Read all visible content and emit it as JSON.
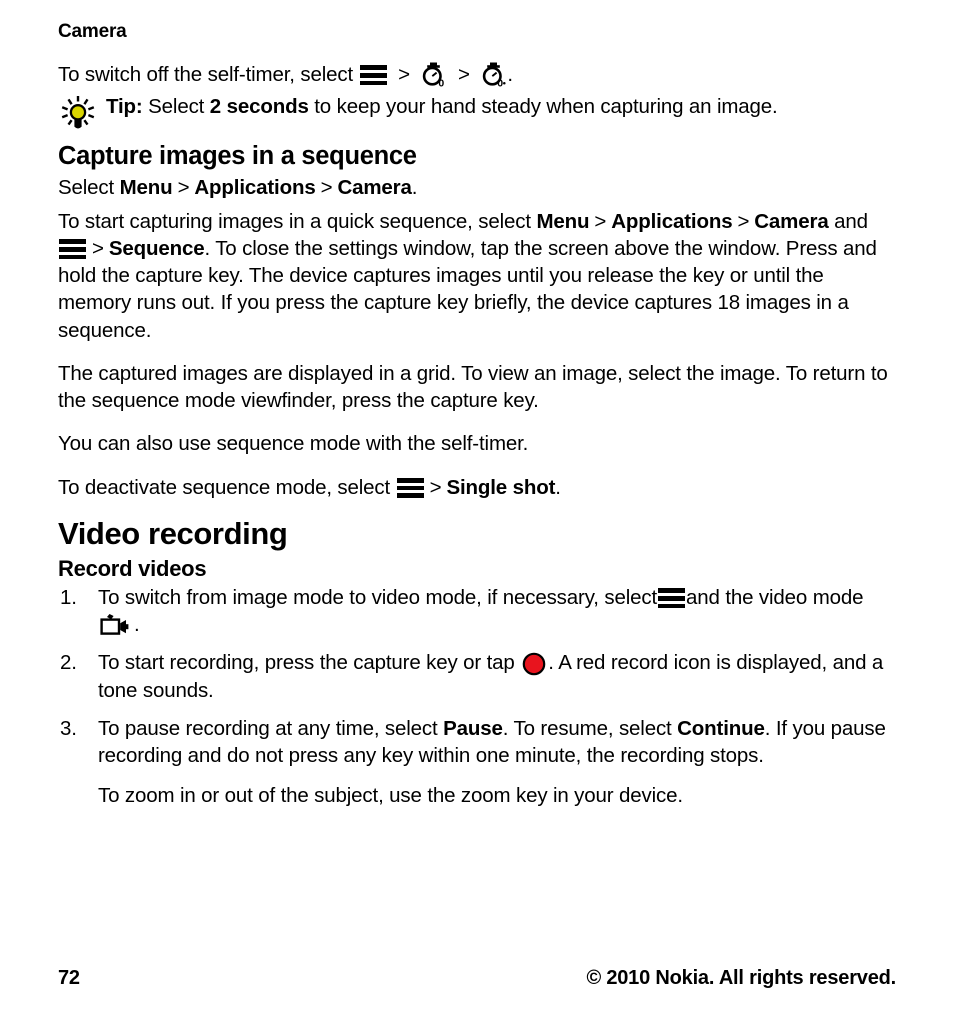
{
  "document": {
    "running_header": "Camera",
    "page_number": "72",
    "copyright": "© 2010 Nokia. All rights reserved."
  },
  "intro": {
    "self_timer_off_before": "To switch off the self-timer, select",
    "self_timer_off_after": ".",
    "separator": ">",
    "icons": {
      "menu": "menu-hamburger-icon",
      "timer_off": "self-timer-off-icon",
      "timer_off_alt": "self-timer-off-selected-icon"
    }
  },
  "tip": {
    "icon": "lightbulb-tip-icon",
    "label": "Tip:",
    "text_before": " Select ",
    "emphasis": "2 seconds",
    "text_after": " to keep your hand steady when capturing an image."
  },
  "sections": {
    "capture_sequence": {
      "heading": "Capture images in a sequence",
      "select_prefix": "Select",
      "path": [
        "Menu",
        "Applications",
        "Camera"
      ],
      "path_suffix": ".",
      "para1_a": "To start capturing images in a quick sequence, select",
      "para1_menu": "Menu",
      "para1_applications": "Applications",
      "para1_camera": "Camera",
      "para1_b": " and ",
      "para1_sequence": "Sequence",
      "para1_c": ". To close the settings window, tap the screen above the window. Press and hold the capture key. The device captures images until you release the key or until the memory runs out. If you press the capture key briefly, the device captures 18 images in a sequence.",
      "para2": "The captured images are displayed in a grid. To view an image, select the image. To return to the sequence mode viewfinder, press the capture key.",
      "para3": "You can also use sequence mode with the self-timer.",
      "para4_a": "To deactivate sequence mode, select",
      "para4_single_shot": "Single shot",
      "para4_b": "."
    },
    "video_recording": {
      "heading": "Video recording",
      "subheading": "Record videos",
      "steps": [
        {
          "number": "1.",
          "text_a": "To switch from image mode to video mode, if necessary, select",
          "text_b": "and the video mode",
          "text_c": ".",
          "icon_menu": "menu-hamburger-icon",
          "icon_video": "video-mode-icon"
        },
        {
          "number": "2.",
          "text_a": "To start recording, press the capture key or tap",
          "text_b": ". A red record icon is displayed, and a tone sounds.",
          "icon_record": "record-button-icon"
        },
        {
          "number": "3.",
          "text_a": "To pause recording at any time, select ",
          "bold_pause": "Pause",
          "text_b": ". To resume, select ",
          "bold_continue": "Continue",
          "text_c": ". If you pause recording and do not press any key within one minute, the recording stops.",
          "sub_para": "To zoom in or out of the subject, use the zoom key in your device."
        }
      ]
    }
  },
  "colors": {
    "text": "#000000",
    "background": "#ffffff",
    "record_red": "#e8141e",
    "bulb_yellow": "#d8d400"
  }
}
